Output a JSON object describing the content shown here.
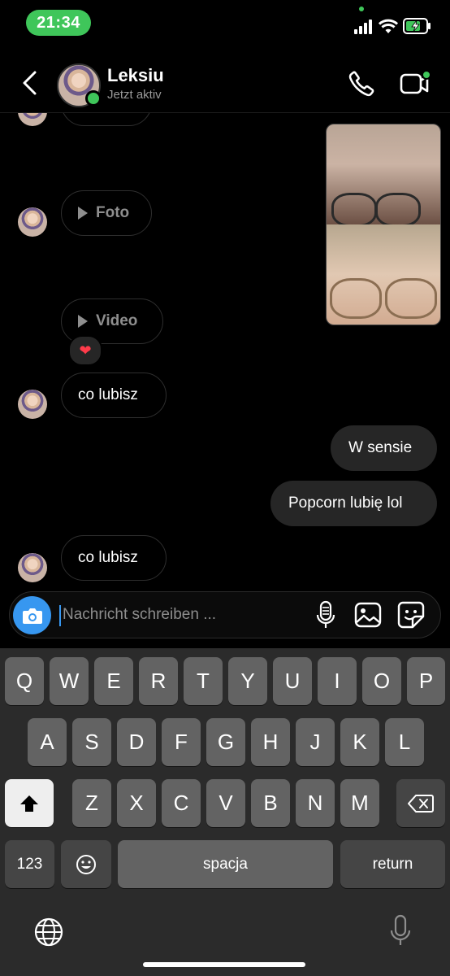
{
  "status_bar": {
    "time": "21:34"
  },
  "header": {
    "contact_name": "Leksiu",
    "contact_status": "Jetzt aktiv"
  },
  "messages": {
    "foto_label": "Foto",
    "video_label": "Video",
    "reaction": "❤",
    "incoming_1": "co lubisz",
    "outgoing_1": "W sensie",
    "outgoing_2": "Popcorn lubię lol",
    "incoming_2": "co lubisz"
  },
  "composer": {
    "placeholder": "Nachricht schreiben ..."
  },
  "keyboard": {
    "row1": [
      "Q",
      "W",
      "E",
      "R",
      "T",
      "Y",
      "U",
      "I",
      "O",
      "P"
    ],
    "row2": [
      "A",
      "S",
      "D",
      "F",
      "G",
      "H",
      "J",
      "K",
      "L"
    ],
    "row3": [
      "Z",
      "X",
      "C",
      "V",
      "B",
      "N",
      "M"
    ],
    "numbers_key": "123",
    "space_key": "spacja",
    "return_key": "return"
  },
  "colors": {
    "accent": "#3797f0",
    "online": "#3fc65a",
    "bubble": "#262626"
  }
}
